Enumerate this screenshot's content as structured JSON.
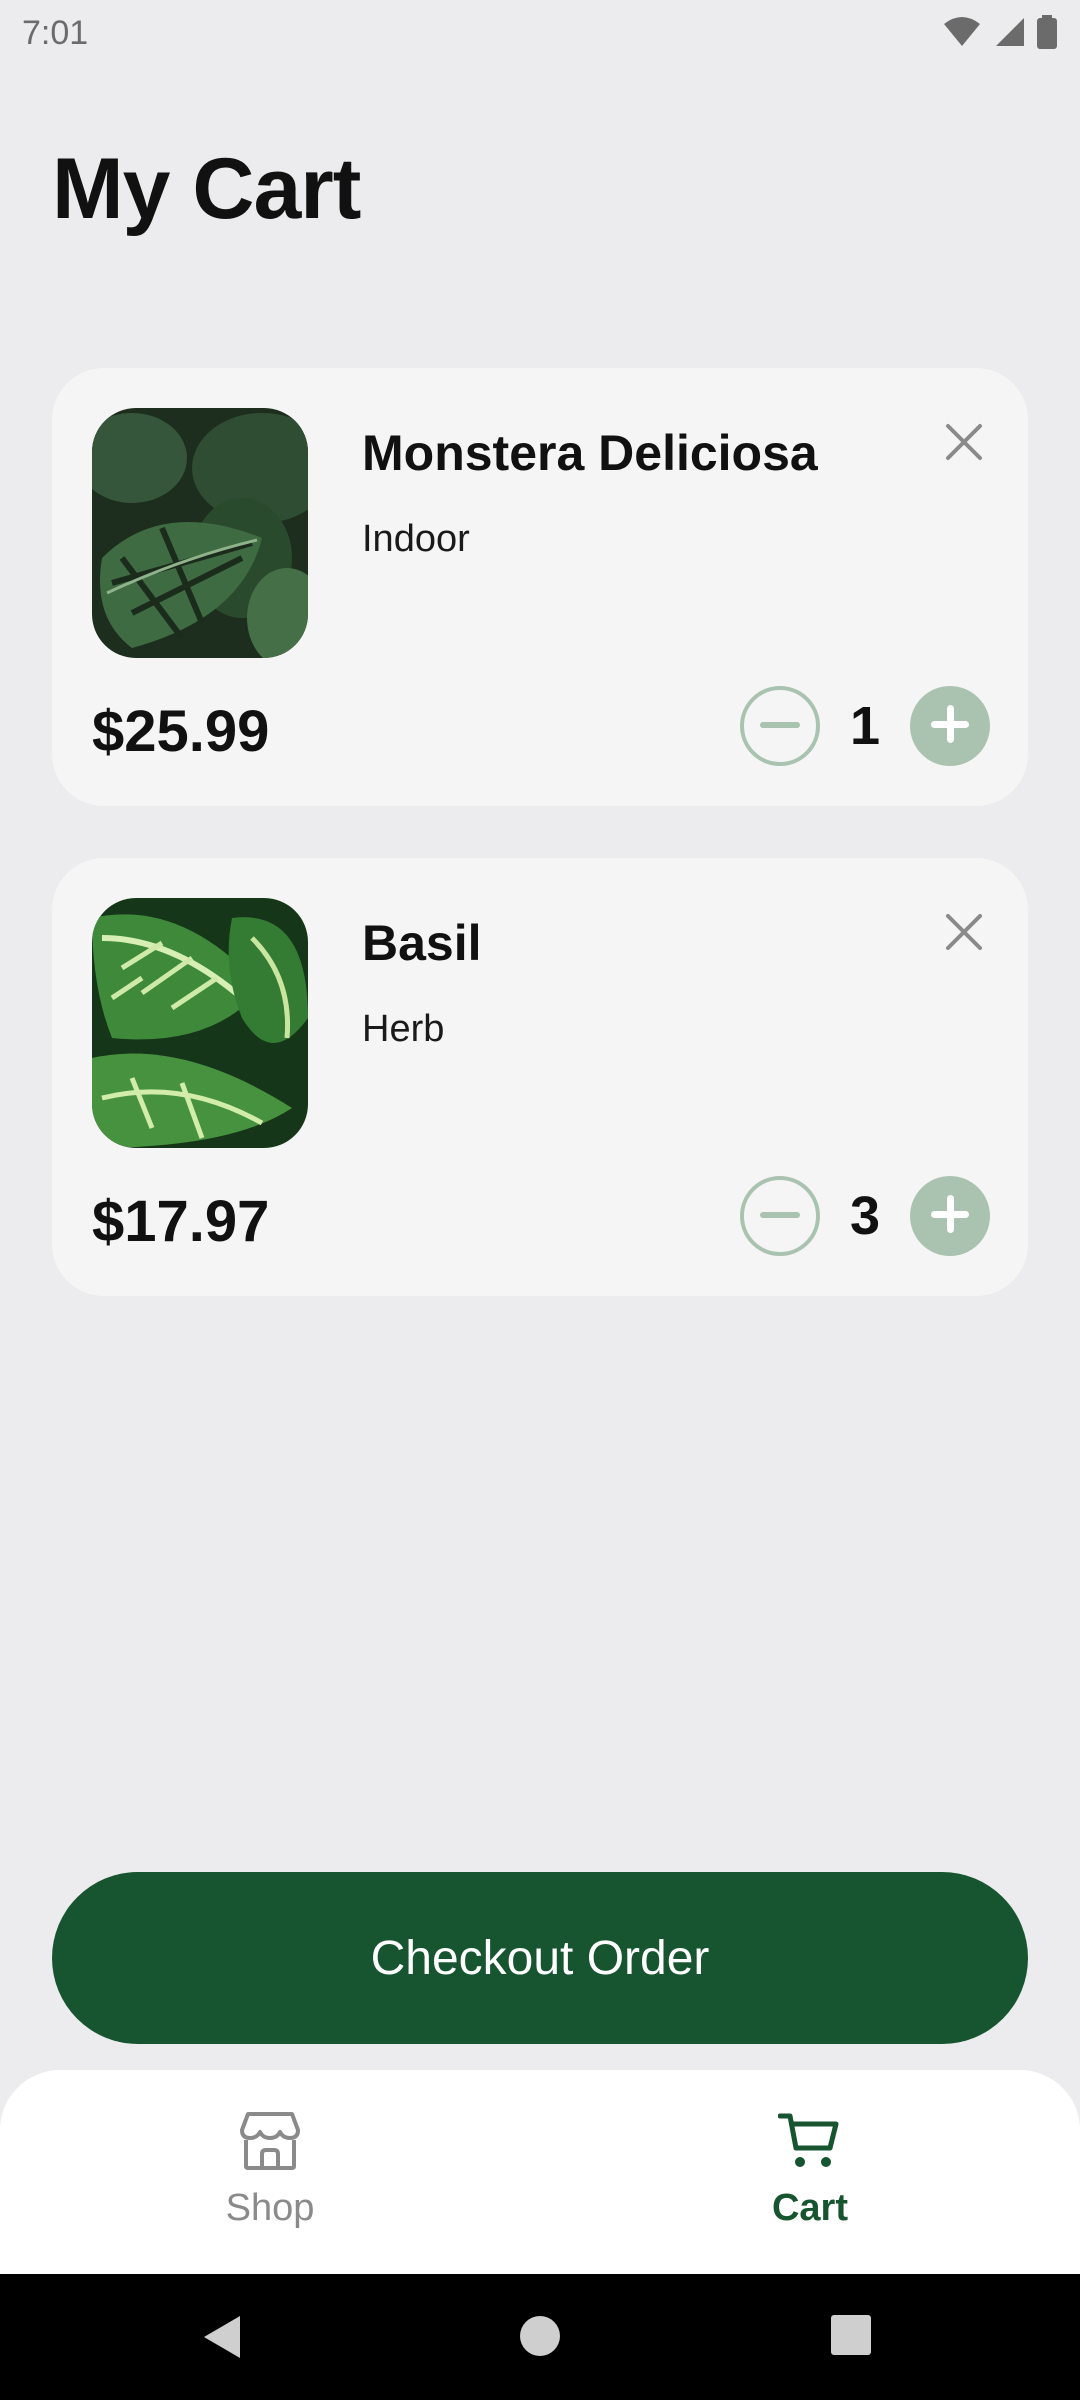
{
  "status_bar": {
    "time": "7:01",
    "icons": [
      "wifi-icon",
      "signal-icon",
      "battery-icon"
    ]
  },
  "page": {
    "title": "My Cart"
  },
  "cart": {
    "items": [
      {
        "name": "Monstera Deliciosa",
        "category": "Indoor",
        "price": "$25.99",
        "quantity": "1",
        "image": "monstera-plant-photo"
      },
      {
        "name": "Basil",
        "category": "Herb",
        "price": "$17.97",
        "quantity": "3",
        "image": "basil-plant-photo"
      }
    ]
  },
  "checkout": {
    "label": "Checkout Order"
  },
  "bottom_nav": {
    "items": [
      {
        "label": "Shop",
        "icon": "store-icon",
        "active": false
      },
      {
        "label": "Cart",
        "icon": "cart-icon",
        "active": true
      }
    ]
  },
  "colors": {
    "background": "#ececee",
    "card": "#f5f5f5",
    "primary": "#16552f",
    "qty_accent": "#a9c3b0",
    "inactive_nav": "#8a8a8a"
  }
}
